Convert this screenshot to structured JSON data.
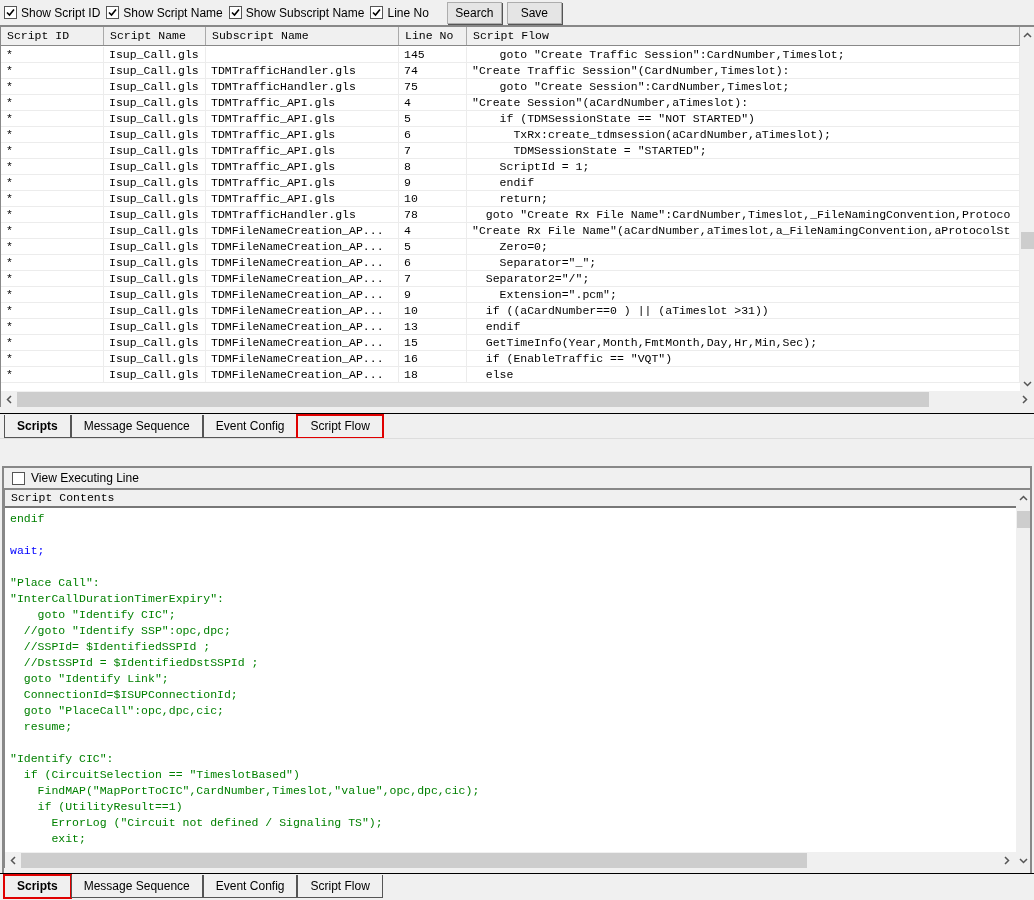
{
  "toolbar": {
    "checkboxes": [
      {
        "label": "Show Script ID",
        "checked": true
      },
      {
        "label": "Show Script Name",
        "checked": true
      },
      {
        "label": "Show Subscript Name",
        "checked": true
      },
      {
        "label": "Line No",
        "checked": true
      }
    ],
    "buttons": [
      "Search",
      "Save"
    ]
  },
  "flow_table": {
    "columns": [
      "Script ID",
      "Script Name",
      "Subscript Name",
      "Line No",
      "Script Flow"
    ],
    "rows": [
      {
        "script_id": "*",
        "script_name": "Isup_Call.gls",
        "line_no": "145",
        "flow": "    goto \"Create Traffic Session\":CardNumber,Timeslot;"
      },
      {
        "script_id": "*",
        "script_name": "Isup_Call.gls",
        "subscript_name": "TDMTrafficHandler.gls",
        "line_no": "74",
        "flow": "\"Create Traffic Session\"(CardNumber,Timeslot):"
      },
      {
        "script_id": "*",
        "script_name": "Isup_Call.gls",
        "subscript_name": "TDMTrafficHandler.gls",
        "line_no": "75",
        "flow": "    goto \"Create Session\":CardNumber,Timeslot;"
      },
      {
        "script_id": "*",
        "script_name": "Isup_Call.gls",
        "subscript_name": "TDMTraffic_API.gls",
        "line_no": "4",
        "flow": "\"Create Session\"(aCardNumber,aTimeslot):"
      },
      {
        "script_id": "*",
        "script_name": "Isup_Call.gls",
        "subscript_name": "TDMTraffic_API.gls",
        "line_no": "5",
        "flow": "    if (TDMSessionState == \"NOT STARTED\")"
      },
      {
        "script_id": "*",
        "script_name": "Isup_Call.gls",
        "subscript_name": "TDMTraffic_API.gls",
        "line_no": "6",
        "flow": "      TxRx:create_tdmsession(aCardNumber,aTimeslot);"
      },
      {
        "script_id": "*",
        "script_name": "Isup_Call.gls",
        "subscript_name": "TDMTraffic_API.gls",
        "line_no": "7",
        "flow": "      TDMSessionState = \"STARTED\";"
      },
      {
        "script_id": "*",
        "script_name": "Isup_Call.gls",
        "subscript_name": "TDMTraffic_API.gls",
        "line_no": "8",
        "flow": "    ScriptId = 1;"
      },
      {
        "script_id": "*",
        "script_name": "Isup_Call.gls",
        "subscript_name": "TDMTraffic_API.gls",
        "line_no": "9",
        "flow": "    endif"
      },
      {
        "script_id": "*",
        "script_name": "Isup_Call.gls",
        "subscript_name": "TDMTraffic_API.gls",
        "line_no": "10",
        "flow": "    return;"
      },
      {
        "script_id": "*",
        "script_name": "Isup_Call.gls",
        "subscript_name": "TDMTrafficHandler.gls",
        "line_no": "78",
        "flow": "  goto \"Create Rx File Name\":CardNumber,Timeslot,_FileNamingConvention,Protoco"
      },
      {
        "script_id": "*",
        "script_name": "Isup_Call.gls",
        "subscript_name": "TDMFileNameCreation_AP...",
        "line_no": "4",
        "flow": "\"Create Rx File Name\"(aCardNumber,aTimeslot,a_FileNamingConvention,aProtocolSt"
      },
      {
        "script_id": "*",
        "script_name": "Isup_Call.gls",
        "subscript_name": "TDMFileNameCreation_AP...",
        "line_no": "5",
        "flow": "    Zero=0;"
      },
      {
        "script_id": "*",
        "script_name": "Isup_Call.gls",
        "subscript_name": "TDMFileNameCreation_AP...",
        "line_no": "6",
        "flow": "    Separator=\"_\";"
      },
      {
        "script_id": "*",
        "script_name": "Isup_Call.gls",
        "subscript_name": "TDMFileNameCreation_AP...",
        "line_no": "7",
        "flow": "  Separator2=\"/\";"
      },
      {
        "script_id": "*",
        "script_name": "Isup_Call.gls",
        "subscript_name": "TDMFileNameCreation_AP...",
        "line_no": "9",
        "flow": "    Extension=\".pcm\";"
      },
      {
        "script_id": "*",
        "script_name": "Isup_Call.gls",
        "subscript_name": "TDMFileNameCreation_AP...",
        "line_no": "10",
        "flow": "  if ((aCardNumber==0 ) || (aTimeslot >31))"
      },
      {
        "script_id": "*",
        "script_name": "Isup_Call.gls",
        "subscript_name": "TDMFileNameCreation_AP...",
        "line_no": "13",
        "flow": "  endif"
      },
      {
        "script_id": "*",
        "script_name": "Isup_Call.gls",
        "subscript_name": "TDMFileNameCreation_AP...",
        "line_no": "15",
        "flow": "  GetTimeInfo(Year,Month,FmtMonth,Day,Hr,Min,Sec);"
      },
      {
        "script_id": "*",
        "script_name": "Isup_Call.gls",
        "subscript_name": "TDMFileNameCreation_AP...",
        "line_no": "16",
        "flow": "  if (EnableTraffic == \"VQT\")"
      },
      {
        "script_id": "*",
        "script_name": "Isup_Call.gls",
        "subscript_name": "TDMFileNameCreation_AP...",
        "line_no": "18",
        "flow": "  else"
      }
    ]
  },
  "top_tabs": [
    {
      "label": "Scripts",
      "selected": true,
      "highlighted": false
    },
    {
      "label": "Message Sequence",
      "selected": false,
      "highlighted": false
    },
    {
      "label": "Event Config",
      "selected": false,
      "highlighted": false
    },
    {
      "label": "Script Flow",
      "selected": false,
      "highlighted": true
    }
  ],
  "view_executing_line": {
    "label": "View Executing Line",
    "checked": false
  },
  "script_contents": {
    "title": "Script Contents",
    "blocks": [
      {
        "lines": [
          {
            "text": "endif",
            "kind": "code"
          }
        ]
      },
      {
        "lines": [
          {
            "text": "wait;",
            "kind": "keyword"
          }
        ]
      },
      {
        "lines": [
          {
            "text": "\"Place Call\":",
            "kind": "code"
          },
          {
            "text": "\"InterCallDurationTimerExpiry\":",
            "kind": "code"
          },
          {
            "text": "    goto \"Identify CIC\";",
            "kind": "code"
          },
          {
            "text": "  //goto \"Identify SSP\":opc,dpc;",
            "kind": "code"
          },
          {
            "text": "  //SSPId= $IdentifiedSSPId ;",
            "kind": "code"
          },
          {
            "text": "  //DstSSPId = $IdentifiedDstSSPId ;",
            "kind": "code"
          },
          {
            "text": "  goto \"Identify Link\";",
            "kind": "code"
          },
          {
            "text": "  ConnectionId=$ISUPConnectionId;",
            "kind": "code"
          },
          {
            "text": "  goto \"PlaceCall\":opc,dpc,cic;",
            "kind": "code"
          },
          {
            "text": "  resume;",
            "kind": "code"
          }
        ]
      },
      {
        "lines": [
          {
            "text": "\"Identify CIC\":",
            "kind": "code"
          },
          {
            "text": "  if (CircuitSelection == \"TimeslotBased\")",
            "kind": "code"
          },
          {
            "text": "    FindMAP(\"MapPortToCIC\",CardNumber,Timeslot,\"value\",opc,dpc,cic);",
            "kind": "code"
          },
          {
            "text": "    if (UtilityResult==1)",
            "kind": "code"
          },
          {
            "text": "      ErrorLog (\"Circuit not defined / Signaling TS\");",
            "kind": "code"
          },
          {
            "text": "      exit;",
            "kind": "code"
          }
        ]
      }
    ]
  },
  "bottom_tabs": [
    {
      "label": "Scripts",
      "selected": true,
      "highlighted": true
    },
    {
      "label": "Message Sequence",
      "selected": false,
      "highlighted": false
    },
    {
      "label": "Event Config",
      "selected": false,
      "highlighted": false
    },
    {
      "label": "Script Flow",
      "selected": false,
      "highlighted": false
    }
  ]
}
